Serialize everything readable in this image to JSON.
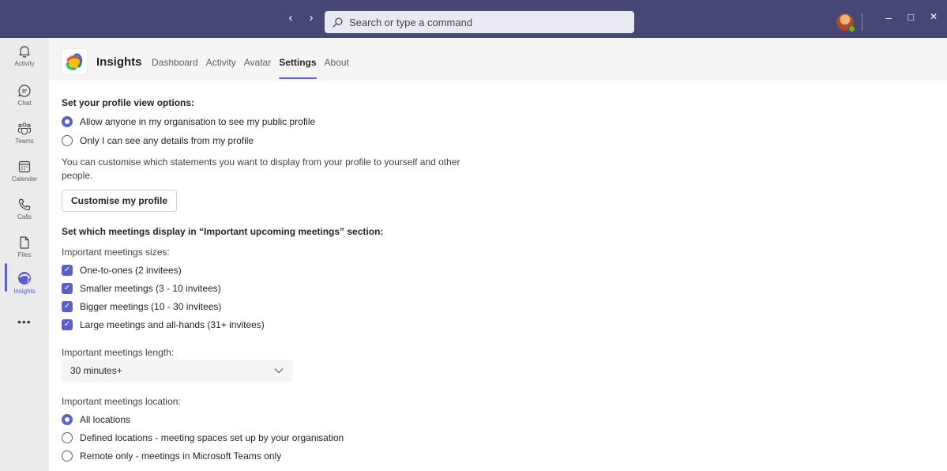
{
  "titlebar": {
    "back_icon": "chevron-left-icon",
    "forward_icon": "chevron-right-icon",
    "search_placeholder": "Search or type a command",
    "minimize": "–",
    "maximize": "□",
    "close": "✕"
  },
  "rail": {
    "items": [
      {
        "label": "Activity",
        "icon": "bell-icon"
      },
      {
        "label": "Chat",
        "icon": "chat-icon"
      },
      {
        "label": "Teams",
        "icon": "teams-icon"
      },
      {
        "label": "Calender",
        "icon": "calendar-icon"
      },
      {
        "label": "Calls",
        "icon": "phone-icon"
      },
      {
        "label": "Files",
        "icon": "file-icon"
      },
      {
        "label": "Insights",
        "icon": "insights-icon"
      }
    ],
    "more": "•••"
  },
  "app": {
    "name": "Insights",
    "tabs": [
      "Dashboard",
      "Activity",
      "Avatar",
      "Settings",
      "About"
    ],
    "active_tab": "Settings"
  },
  "settings": {
    "profile_title": "Set your profile view options:",
    "profile_options": [
      {
        "label": "Allow anyone in my organisation to see my public profile",
        "checked": true
      },
      {
        "label": "Only I can see any details from my profile",
        "checked": false
      }
    ],
    "customise_text": "You can customise which statements you want to display from your profile to yourself and other people.",
    "customise_button": "Customise my profile",
    "meetings_title": "Set which meetings display in “Important upcoming meetings” section:",
    "sizes_label": "Important meetings sizes:",
    "sizes": [
      {
        "label": "One-to-ones (2 invitees)",
        "checked": true
      },
      {
        "label": "Smaller meetings (3 - 10 invitees)",
        "checked": true
      },
      {
        "label": "Bigger meetings (10 - 30 invitees)",
        "checked": true
      },
      {
        "label": "Large meetings and all-hands (31+ invitees)",
        "checked": true
      }
    ],
    "length_label": "Important meetings length:",
    "length_value": "30 minutes+",
    "location_label": "Important meetings location:",
    "locations": [
      {
        "label": "All locations",
        "checked": true
      },
      {
        "label": "Defined locations - meeting spaces set up by your organisation",
        "checked": false
      },
      {
        "label": "Remote only - meetings in Microsoft Teams only",
        "checked": false
      }
    ]
  },
  "colors": {
    "titlebar": "#464775",
    "accent": "#5b5fc7",
    "rail": "#ebebeb"
  }
}
